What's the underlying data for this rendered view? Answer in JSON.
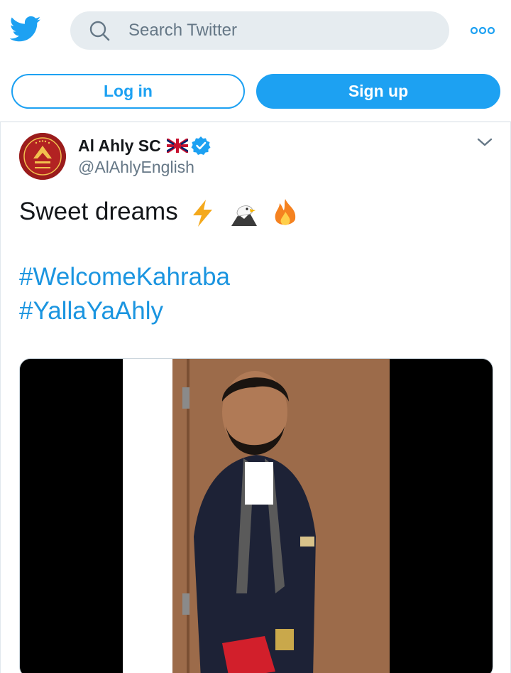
{
  "header": {
    "logo_icon": "twitter-bird-icon",
    "search": {
      "placeholder": "Search Twitter",
      "icon": "search-icon"
    },
    "more_icon": "more-icon"
  },
  "auth": {
    "login_label": "Log in",
    "signup_label": "Sign up"
  },
  "tweet": {
    "author": {
      "display_name": "Al Ahly SC",
      "handle": "@AlAhlyEnglish",
      "flag_icon": "uk-flag-icon",
      "verified_icon": "verified-badge-icon",
      "avatar": "al-ahly-crest-avatar"
    },
    "text": "Sweet dreams",
    "emojis": [
      "lightning-emoji",
      "eagle-emoji",
      "fire-emoji"
    ],
    "hashtags": [
      "#WelcomeKahraba",
      "#YallaYaAhly"
    ],
    "media": {
      "type": "video"
    }
  },
  "colors": {
    "brand_blue": "#1da1f2",
    "hashtag_blue": "#1b95e0",
    "search_bg": "#e6ecf0",
    "muted_text": "#657786"
  }
}
